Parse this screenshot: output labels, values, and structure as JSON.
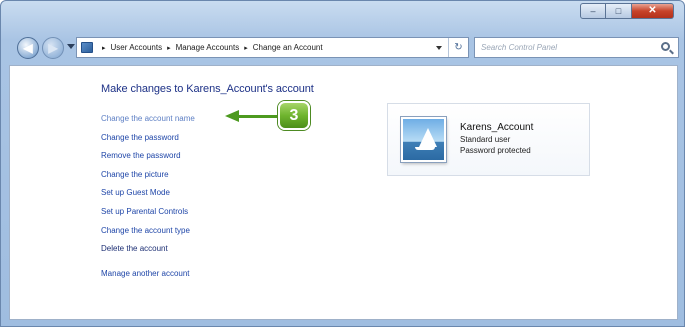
{
  "window": {
    "controls": {
      "minimize": "–",
      "maximize": "□",
      "close": "✕"
    }
  },
  "nav": {
    "back": "◀",
    "forward": "▶"
  },
  "address_bar": {
    "icon": "control-panel-icon",
    "separator": "▸",
    "breadcrumbs": [
      "User Accounts",
      "Manage Accounts",
      "Change an Account"
    ],
    "refresh": "↻"
  },
  "search": {
    "placeholder": "Search Control Panel",
    "icon": "search-icon"
  },
  "page": {
    "title": "Make changes to Karens_Account's account",
    "tasks": [
      "Change the account name",
      "Change the password",
      "Remove the password",
      "Change the picture",
      "Set up Guest Mode",
      "Set up Parental Controls",
      "Change the account type",
      "Delete the account"
    ],
    "other_task": "Manage another account"
  },
  "callout": {
    "step": "3",
    "color": "#4d9a1f"
  },
  "account": {
    "name": "Karens_Account",
    "type": "Standard user",
    "status": "Password protected",
    "picture_icon": "sailboat-icon"
  }
}
